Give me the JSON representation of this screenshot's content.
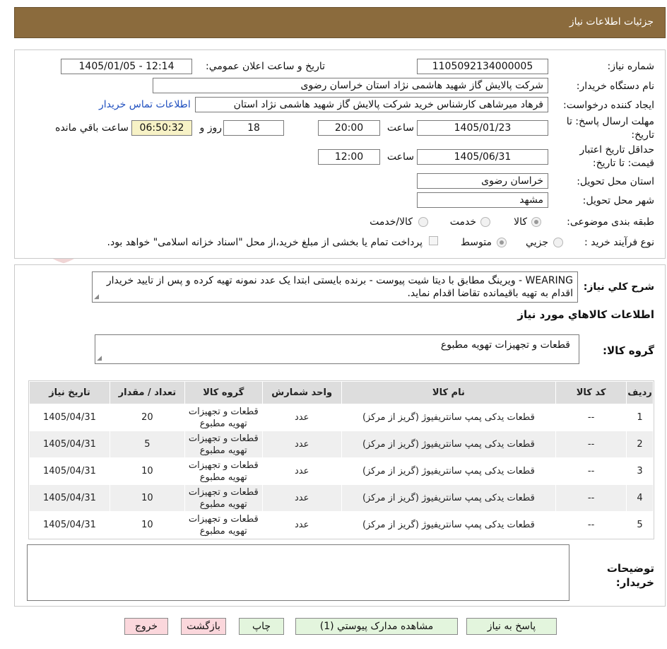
{
  "header": {
    "title": "جزئیات اطلاعات نیاز"
  },
  "form": {
    "need_number_label": "شماره نیاز:",
    "need_number": "1105092134000005",
    "announce_label": "تاریخ و ساعت اعلان عمومي:",
    "announce_value": "1405/01/05 - 12:14",
    "buyer_org_label": "نام دستگاه خریدار:",
    "buyer_org": "شرکت پالایش گاز شهید هاشمی نژاد   استان خراسان رضوی",
    "requester_label": "ایجاد کننده درخواست:",
    "requester": "فرهاد میرشاهی کارشناس خرید شرکت پالایش گاز شهید هاشمی نژاد   استان",
    "contact_link": "اطلاعات تماس خریدار",
    "deadline_label": "مهلت ارسال پاسخ: تا تاریخ:",
    "deadline_date": "1405/01/23",
    "time_word": "ساعت",
    "deadline_time": "20:00",
    "days_value": "18",
    "days_word": "روز و",
    "remaining_time": "06:50:32",
    "remaining_word": "ساعت باقي مانده",
    "validity_label": "حداقل تاریخ اعتبار قیمت: تا تاریخ:",
    "validity_date": "1405/06/31",
    "validity_time": "12:00",
    "province_label": "استان محل تحویل:",
    "province": "خراسان رضوی",
    "city_label": "شهر محل تحویل:",
    "city": "مشهد",
    "category_label": "طبقه بندی موضوعی:",
    "category_options": [
      "کالا",
      "خدمت",
      "کالا/خدمت"
    ],
    "process_label": "نوع فرآیند خرید :",
    "process_options": [
      "جزیي",
      "متوسط"
    ],
    "payment_note": "پرداخت تمام یا بخشی از مبلغ خرید،از محل \"اسناد خزانه اسلامی\" خواهد بود."
  },
  "description": {
    "label": "شرح کلي نیاز:",
    "text": "WEARING - ویرینگ مطابق با دیتا شیت پیوست - برنده بایستی ابتدا یک عدد نمونه تهیه کرده و پس از تایید خریدار اقدام به تهیه باقیمانده تقاضا اقدام نماید."
  },
  "items_section": {
    "title": "اطلاعات کالاهاي مورد نیاز",
    "group_label": "گروه کالا:",
    "group_value": "قطعات و تجهیزات تهویه مطبوع"
  },
  "table": {
    "headers": [
      "ردیف",
      "کد کالا",
      "نام کالا",
      "واحد شمارش",
      "گروه کالا",
      "تعداد / مقدار",
      "تاریخ نیاز"
    ],
    "rows": [
      [
        "1",
        "--",
        "قطعات یدکی پمپ سانتریفیوژ (گریز از مرکز)",
        "عدد",
        "قطعات و تجهیزات تهویه مطبوع",
        "20",
        "1405/04/31"
      ],
      [
        "2",
        "--",
        "قطعات یدکی پمپ سانتریفیوژ (گریز از مرکز)",
        "عدد",
        "قطعات و تجهیزات تهویه مطبوع",
        "5",
        "1405/04/31"
      ],
      [
        "3",
        "--",
        "قطعات یدکی پمپ سانتریفیوژ (گریز از مرکز)",
        "عدد",
        "قطعات و تجهیزات تهویه مطبوع",
        "10",
        "1405/04/31"
      ],
      [
        "4",
        "--",
        "قطعات یدکی پمپ سانتریفیوژ (گریز از مرکز)",
        "عدد",
        "قطعات و تجهیزات تهویه مطبوع",
        "10",
        "1405/04/31"
      ],
      [
        "5",
        "--",
        "قطعات یدکی پمپ سانتریفیوژ (گریز از مرکز)",
        "عدد",
        "قطعات و تجهیزات تهویه مطبوع",
        "10",
        "1405/04/31"
      ]
    ]
  },
  "notes": {
    "label": "توضیحات خریدار:"
  },
  "buttons": {
    "reply": "پاسخ به نیاز",
    "attachments": "مشاهده مدارک پیوستي (1)",
    "print": "چاپ",
    "back": "بازگشت",
    "exit": "خروج"
  },
  "watermark": {
    "text": "AriaTender.neT"
  },
  "colors": {
    "header": "#8b6b3d",
    "link": "#1f4fbf",
    "green_button": "#e3f5dd",
    "pink_button": "#fbd7dc",
    "remaining_box": "#f7f2c6"
  }
}
